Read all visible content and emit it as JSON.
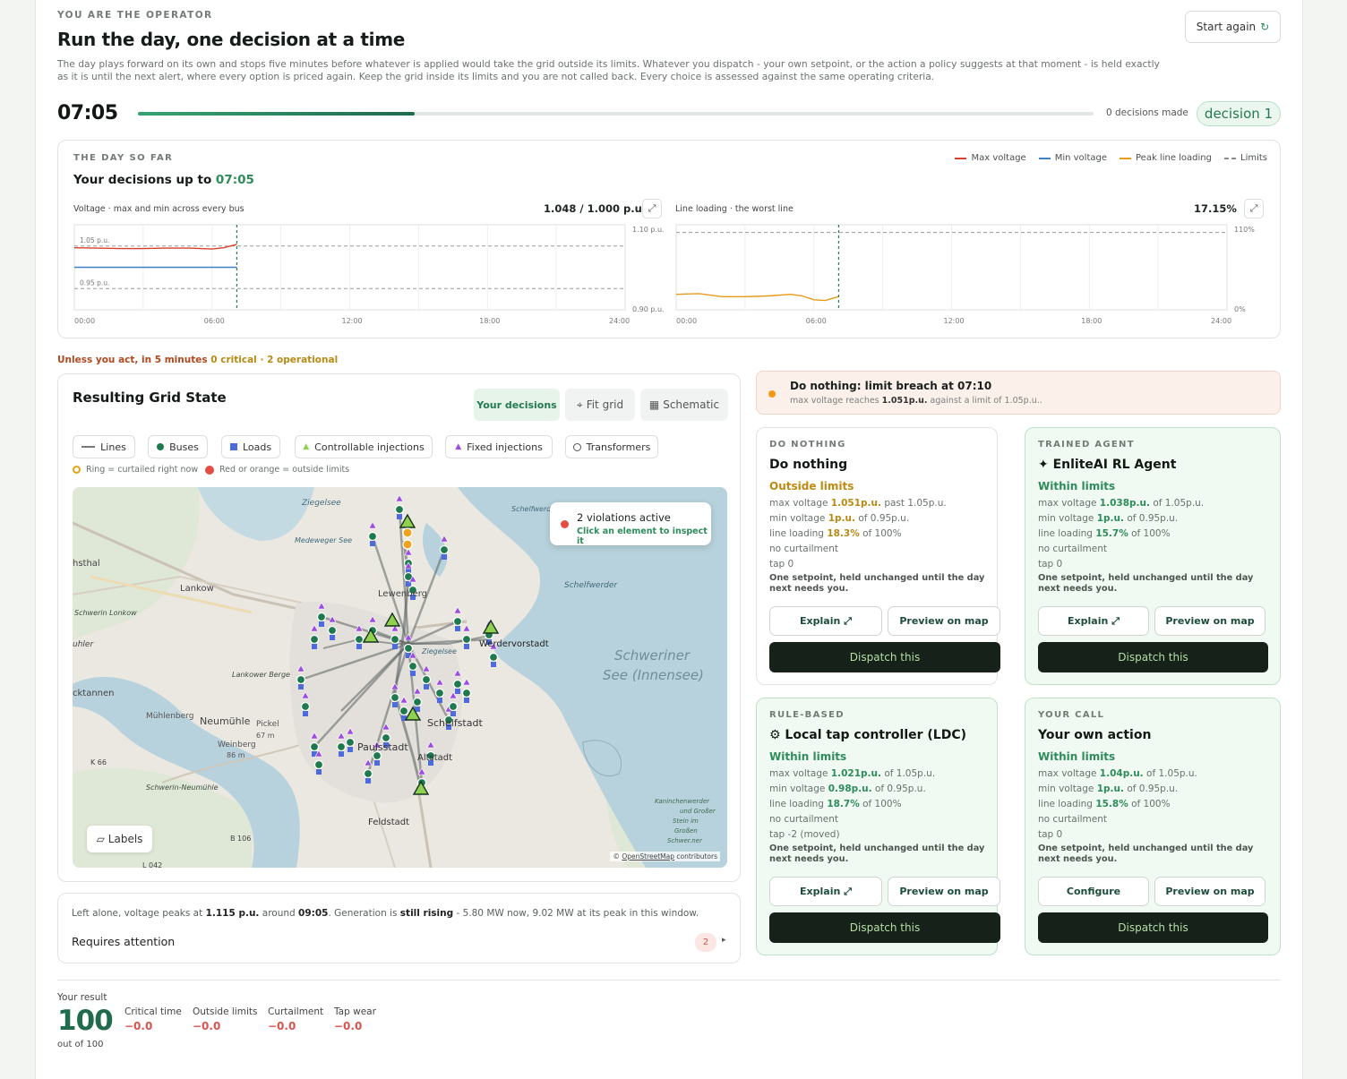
{
  "header": {
    "eyebrow": "YOU ARE THE OPERATOR",
    "title": "Run the day, one decision at a time",
    "intro": "The day plays forward on its own and stops five minutes before whatever is applied would take the grid outside its limits. Whatever you dispatch - your own setpoint, or the action a policy suggests at that moment - is held exactly as it is until the next alert, where every option is priced again. Keep the grid inside its limits and you are not called back. Every choice is assessed against the same operating criteria.",
    "restart_label": "Start again",
    "restart_icon": "refresh-icon"
  },
  "timeline": {
    "clock": "07:05",
    "progress": 0.29,
    "decisions_text": "0 decisions made",
    "decision_badge": "decision 1"
  },
  "day_so_far": {
    "eyebrow": "THE DAY SO FAR",
    "title_prefix": "Your decisions up to",
    "title_time": "07:05",
    "legend": [
      {
        "label": "Max voltage",
        "color": "#d9402b"
      },
      {
        "label": "Min voltage",
        "color": "#3f7fc4"
      },
      {
        "label": "Peak line loading",
        "color": "#e79a1a"
      },
      {
        "label": "Limits",
        "color": "#888888"
      }
    ],
    "voltage": {
      "label": "Voltage · max and min across every bus",
      "value": "1.048 / 1.000 p.u.",
      "ymax_label": "1.10 p.u.",
      "ymin_label": "0.90 p.u.",
      "hi_limit_label": "1.05 p.u.",
      "lo_limit_label": "0.95 p.u."
    },
    "loading": {
      "label": "Line loading · the worst line",
      "value": "17.15%",
      "ymax_label": "110%",
      "ymin_label": "0%"
    },
    "x_ticks": [
      "00:00",
      "06:00",
      "12:00",
      "18:00",
      "24:00"
    ],
    "expand_icon": "expand-icon"
  },
  "chart_data": [
    {
      "type": "line",
      "title": "Voltage · max and min across every bus",
      "ylim": [
        0.9,
        1.1
      ],
      "xlim": [
        0,
        24
      ],
      "series": [
        {
          "name": "Max voltage",
          "x": [
            0,
            1,
            2,
            3,
            4,
            5,
            6,
            6.5,
            7.08
          ],
          "y": [
            1.046,
            1.045,
            1.044,
            1.044,
            1.045,
            1.045,
            1.043,
            1.046,
            1.054
          ]
        },
        {
          "name": "Min voltage",
          "x": [
            0,
            7.08
          ],
          "y": [
            1.0,
            1.0
          ]
        }
      ],
      "limits": [
        1.05,
        0.95
      ]
    },
    {
      "type": "line",
      "title": "Line loading · the worst line",
      "ylim": [
        0,
        110
      ],
      "xlim": [
        0,
        24
      ],
      "series": [
        {
          "name": "Peak line loading",
          "x": [
            0,
            1,
            2,
            3,
            4,
            5,
            5.5,
            6,
            6.5,
            7.08
          ],
          "y": [
            20,
            21,
            17,
            17,
            18,
            20,
            18,
            13,
            12,
            17.15
          ]
        }
      ]
    }
  ],
  "alert_line": {
    "prefix": "Unless you act, in 5 minutes",
    "critical": "0 critical",
    "sep": "·",
    "operational": "2 operational"
  },
  "grid_state": {
    "title": "Resulting Grid State",
    "views": [
      "Your decisions",
      "Fit grid",
      "Schematic"
    ],
    "filters": [
      "Lines",
      "Buses",
      "Loads",
      "Controllable injections",
      "Fixed injections",
      "Transformers"
    ],
    "hint1": "Ring = curtailed right now",
    "hint2": "Red or orange = outside limits",
    "violations_title": "2 violations active",
    "violations_sub": "Click an element to inspect it",
    "labels_btn": "Labels",
    "attribution_prefix": "©",
    "attribution_link": "OpenStreetMap",
    "attribution_suffix": "contributors",
    "places": [
      "Ziegelsee",
      "Schelfwerder",
      "Schelfwerder",
      "Lankow",
      "Schwerin Lonkow",
      "Medeweger See",
      "Lewenberg",
      "Werdervorstadt",
      "Schweriner",
      "See (Innensee)",
      "Lankower Berge",
      "Neumühle",
      "Pickel",
      "67 m",
      "Weinberg",
      "86 m",
      "Mühlenberg",
      "K 66",
      "Schwerin-Neumühle",
      "Feldstadt",
      "B 106",
      "L 042",
      "Kaninchenwerder",
      "und Großer",
      "Stein im",
      "Großen",
      "Schwer.ner",
      "Schelfstadt",
      "Paulsstadt",
      "Ziegelsee",
      "Altstadt",
      "hsthal",
      "cktannen",
      "uhler"
    ]
  },
  "outlook": {
    "text_a": "Left alone, voltage peaks at",
    "peak": "1.115 p.u.",
    "text_b": "around",
    "peak_time": "09:05",
    "text_c": ". Generation is",
    "trend": "still rising",
    "text_d": "- 5.80 MW now, 9.02 MW at its peak in this window.",
    "requires": "Requires attention",
    "count": "2"
  },
  "breach": {
    "title": "Do nothing: limit breach at 07:10",
    "sub_a": "max voltage reaches",
    "value": "1.051p.u.",
    "sub_b": "against a limit of 1.05p.u.."
  },
  "options": [
    {
      "eyebrow": "DO NOTHING",
      "title": "Do nothing",
      "status": "Outside limits",
      "status_color": "#c08a10",
      "lines": [
        {
          "k": "max voltage",
          "v": "1.051p.u.",
          "s": "past 1.05p.u."
        },
        {
          "k": "min voltage",
          "v": "1p.u.",
          "s": "of 0.95p.u."
        },
        {
          "k": "line loading",
          "v": "18.3%",
          "s": "of 100%"
        },
        {
          "k": "no curtailment",
          "v": "",
          "s": ""
        },
        {
          "k": "tap 0",
          "v": "",
          "s": ""
        }
      ],
      "note": "One setpoint, held unchanged until the day next needs you.",
      "b1": "Explain ⤢",
      "b2": "Preview on map",
      "dispatch": "Dispatch this"
    },
    {
      "eyebrow": "TRAINED AGENT",
      "title": "✦ EnliteAI RL Agent",
      "status": "Within limits",
      "status_color": "#2d8c5a",
      "lines": [
        {
          "k": "max voltage",
          "v": "1.038p.u.",
          "s": "of 1.05p.u."
        },
        {
          "k": "min voltage",
          "v": "1p.u.",
          "s": "of 0.95p.u."
        },
        {
          "k": "line loading",
          "v": "15.7%",
          "s": "of 100%"
        },
        {
          "k": "no curtailment",
          "v": "",
          "s": ""
        },
        {
          "k": "tap 0",
          "v": "",
          "s": ""
        }
      ],
      "note": "One setpoint, held unchanged until the day next needs you.",
      "b1": "Explain ⤢",
      "b2": "Preview on map",
      "dispatch": "Dispatch this"
    },
    {
      "eyebrow": "RULE-BASED",
      "title": "⚙ Local tap controller (LDC)",
      "status": "Within limits",
      "status_color": "#2d8c5a",
      "lines": [
        {
          "k": "max voltage",
          "v": "1.021p.u.",
          "s": "of 1.05p.u."
        },
        {
          "k": "min voltage",
          "v": "0.98p.u.",
          "s": "of 0.95p.u."
        },
        {
          "k": "line loading",
          "v": "18.7%",
          "s": "of 100%"
        },
        {
          "k": "no curtailment",
          "v": "",
          "s": ""
        },
        {
          "k": "tap -2 (moved)",
          "v": "",
          "s": ""
        }
      ],
      "note": "One setpoint, held unchanged until the day next needs you.",
      "b1": "Explain ⤢",
      "b2": "Preview on map",
      "dispatch": "Dispatch this"
    },
    {
      "eyebrow": "YOUR CALL",
      "title": "Your own action",
      "status": "Within limits",
      "status_color": "#2d8c5a",
      "lines": [
        {
          "k": "max voltage",
          "v": "1.04p.u.",
          "s": "of 1.05p.u."
        },
        {
          "k": "min voltage",
          "v": "1p.u.",
          "s": "of 0.95p.u."
        },
        {
          "k": "line loading",
          "v": "15.8%",
          "s": "of 100%"
        },
        {
          "k": "no curtailment",
          "v": "",
          "s": ""
        },
        {
          "k": "tap 0",
          "v": "",
          "s": ""
        }
      ],
      "note": "One setpoint, held unchanged until the day next needs you.",
      "b1": "Configure",
      "b2": "Preview on map",
      "dispatch": "Dispatch this"
    }
  ],
  "result": {
    "label": "Your result",
    "score": "100",
    "out_of": "out of 100",
    "metrics": [
      {
        "k": "Critical time",
        "v": "−0.0"
      },
      {
        "k": "Outside limits",
        "v": "−0.0"
      },
      {
        "k": "Curtailment",
        "v": "−0.0"
      },
      {
        "k": "Tap wear",
        "v": "−0.0"
      }
    ]
  },
  "colors": {
    "accent": "#237a50",
    "danger": "#d9534f",
    "warning": "#c08a10",
    "dispatch_bg": "#162119"
  }
}
